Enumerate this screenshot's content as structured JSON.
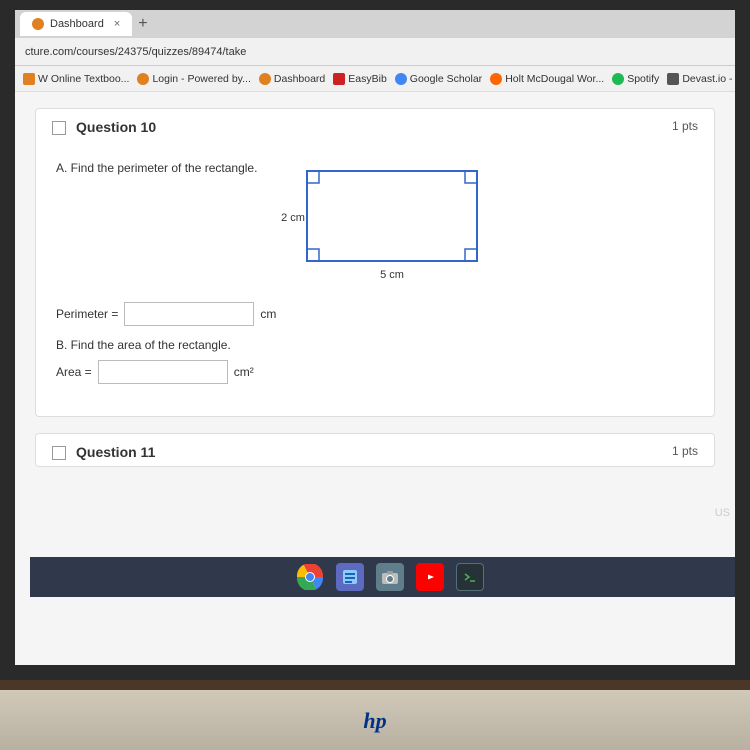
{
  "browser": {
    "tab_title": "Dashboard",
    "tab_icon": "dashboard-icon",
    "url": "cture.com/courses/24375/quizzes/89474/take",
    "bookmarks": [
      {
        "label": "W Online Textboo...",
        "icon_color": "#e08020"
      },
      {
        "label": "Login - Powered by...",
        "icon_color": "#e08020"
      },
      {
        "label": "Dashboard",
        "icon_color": "#e08020"
      },
      {
        "label": "EasyBib",
        "icon_color": "#cc0000"
      },
      {
        "label": "Google Scholar",
        "icon_color": "#4285f4"
      },
      {
        "label": "Holt McDougal Wor...",
        "icon_color": "#ff6600"
      },
      {
        "label": "Spotify",
        "icon_color": "#1db954"
      },
      {
        "label": "Devast.io - The Onli...",
        "icon_color": "#333"
      }
    ]
  },
  "page": {
    "questions": [
      {
        "number": "Question 10",
        "pts": "1 pts",
        "part_a_label": "A. Find the perimeter of the rectangle.",
        "dim_width": "5 cm",
        "dim_height": "2 cm",
        "perimeter_label": "Perimeter =",
        "perimeter_unit": "cm",
        "perimeter_value": "",
        "part_b_label": "B. Find the area of the rectangle.",
        "area_label": "Area =",
        "area_unit": "cm²",
        "area_value": ""
      },
      {
        "number": "Question 11",
        "pts": "1 pts"
      }
    ]
  },
  "taskbar": {
    "icons": [
      "chrome",
      "files",
      "camera",
      "youtube",
      "terminal"
    ],
    "locale": "US"
  },
  "laptop": {
    "brand": "hp"
  }
}
